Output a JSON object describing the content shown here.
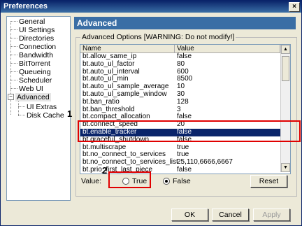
{
  "window": {
    "title": "Preferences",
    "close_glyph": "×"
  },
  "tree": {
    "items": [
      "General",
      "UI Settings",
      "Directories",
      "Connection",
      "Bandwidth",
      "BitTorrent",
      "Queueing",
      "Scheduler",
      "Web UI",
      "Advanced",
      "UI Extras",
      "Disk Cache"
    ],
    "expander": "−"
  },
  "header": {
    "title": "Advanced"
  },
  "group": {
    "legend": "Advanced Options [WARNING: Do not modify!]"
  },
  "table": {
    "columns": [
      "Name",
      "Value"
    ],
    "rows": [
      [
        "bt.allow_same_ip",
        "false"
      ],
      [
        "bt.auto_ul_factor",
        "80"
      ],
      [
        "bt.auto_ul_interval",
        "600"
      ],
      [
        "bt.auto_ul_min",
        "8500"
      ],
      [
        "bt.auto_ul_sample_average",
        "10"
      ],
      [
        "bt.auto_ul_sample_window",
        "30"
      ],
      [
        "bt.ban_ratio",
        "128"
      ],
      [
        "bt.ban_threshold",
        "3"
      ],
      [
        "bt.compact_allocation",
        "false"
      ],
      [
        "bt.connect_speed",
        "20"
      ],
      [
        "bt.enable_tracker",
        "false"
      ],
      [
        "bt.graceful_shutdown",
        "false"
      ],
      [
        "bt.multiscrape",
        "true"
      ],
      [
        "bt.no_connect_to_services",
        "true"
      ],
      [
        "bt.no_connect_to_services_list",
        "25,110,6666,6667"
      ],
      [
        "bt.prio_first_last_piece",
        "false"
      ]
    ],
    "selected_row": "bt.enable_tracker"
  },
  "value_editor": {
    "label": "Value:",
    "true_label": "True",
    "false_label": "False",
    "selected": "False",
    "reset_label": "Reset"
  },
  "buttons": {
    "ok": "OK",
    "cancel": "Cancel",
    "apply": "Apply"
  },
  "annotations": {
    "marker1": "1",
    "marker2": "2"
  },
  "colors": {
    "header_bg": "#3a6ea5",
    "selection_bg": "#0a246a",
    "annotation_red": "#e00000"
  },
  "icons": {
    "scroll_up": "scroll-up-arrow-icon",
    "scroll_down": "scroll-down-arrow-icon"
  }
}
